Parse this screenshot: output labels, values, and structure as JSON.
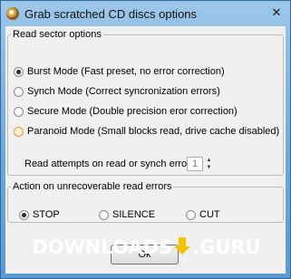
{
  "window": {
    "title": "Grab scratched CD discs options",
    "close_glyph": "✕"
  },
  "read_sector": {
    "legend": "Read sector options",
    "options": [
      {
        "label": "Burst Mode (Fast preset, no error correction)",
        "checked": true
      },
      {
        "label": "Synch Mode (Correct syncronization errors)",
        "checked": false
      },
      {
        "label": "Secure Mode (Double precision eror correction)",
        "checked": false
      },
      {
        "label": "Paranoid Mode (Small blocks read, drive cache disabled)",
        "checked": false
      }
    ],
    "attempts_label": "Read attempts on read or synch error:",
    "attempts_value": "1"
  },
  "unrecoverable": {
    "legend": "Action on unrecoverable read errors",
    "options": [
      {
        "label": "STOP",
        "checked": true
      },
      {
        "label": "SILENCE",
        "checked": false
      },
      {
        "label": "CUT",
        "checked": false
      }
    ]
  },
  "buttons": {
    "ok_label": "Ok"
  },
  "watermark": {
    "left_text": "DOWNLOADS",
    "right_text": ".GURU"
  },
  "colors": {
    "titlebar": "#8dbde4",
    "accent": "#f5c400",
    "frame": "#5b9ad2"
  },
  "icons": [
    "app-icon",
    "close-icon",
    "spin-up-icon",
    "spin-down-icon",
    "download-arrow-icon"
  ]
}
